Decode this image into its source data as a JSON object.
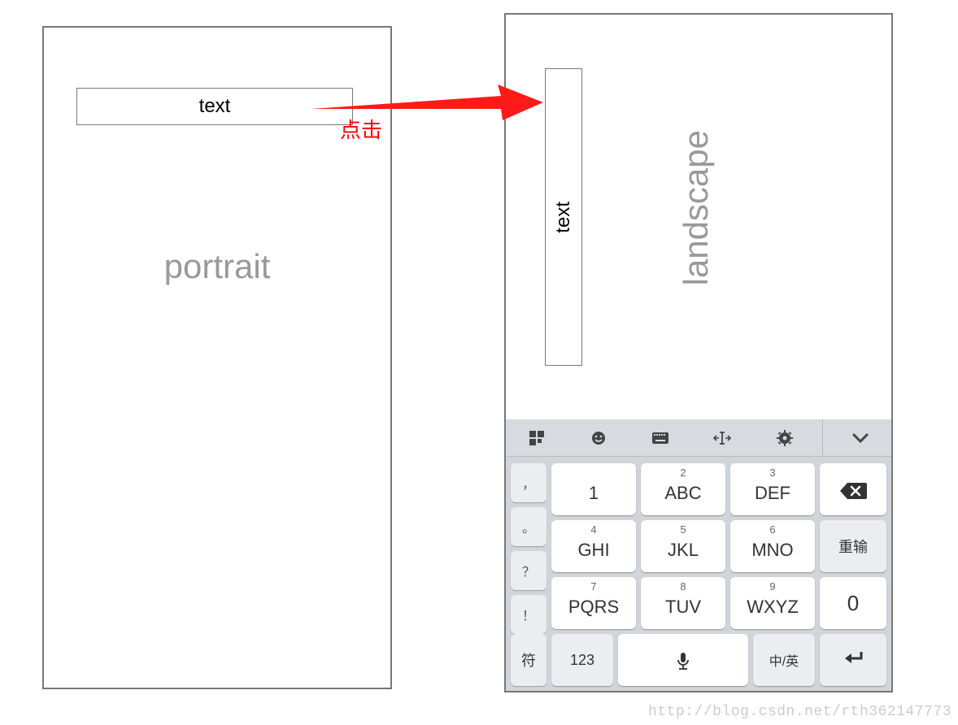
{
  "arrow": {
    "click_label": "点击"
  },
  "portrait": {
    "input_text": "text",
    "orientation_label": "portrait"
  },
  "landscape": {
    "input_text": "text",
    "orientation_label": "landscape"
  },
  "keyboard": {
    "toolbar": {
      "icons": [
        "grid-icon",
        "emoji-icon",
        "keyboard-icon",
        "cursor-icon",
        "gear-icon",
        "collapse-icon"
      ]
    },
    "left_column": [
      "，",
      "。",
      "？",
      "！"
    ],
    "rows": [
      [
        {
          "sup": "",
          "main": "1"
        },
        {
          "sup": "2",
          "main": "ABC"
        },
        {
          "sup": "3",
          "main": "DEF"
        }
      ],
      [
        {
          "sup": "4",
          "main": "GHI"
        },
        {
          "sup": "5",
          "main": "JKL"
        },
        {
          "sup": "6",
          "main": "MNO"
        }
      ],
      [
        {
          "sup": "7",
          "main": "PQRS"
        },
        {
          "sup": "8",
          "main": "TUV"
        },
        {
          "sup": "9",
          "main": "WXYZ"
        }
      ]
    ],
    "bottom_row": {
      "left": "符",
      "num": "123",
      "mic": "mic-icon",
      "lang": "中/英"
    },
    "right_column": {
      "backspace": "⌫",
      "reinput": "重输",
      "zero": "0",
      "enter": "↵"
    }
  },
  "watermark": "http://blog.csdn.net/rth362147773"
}
